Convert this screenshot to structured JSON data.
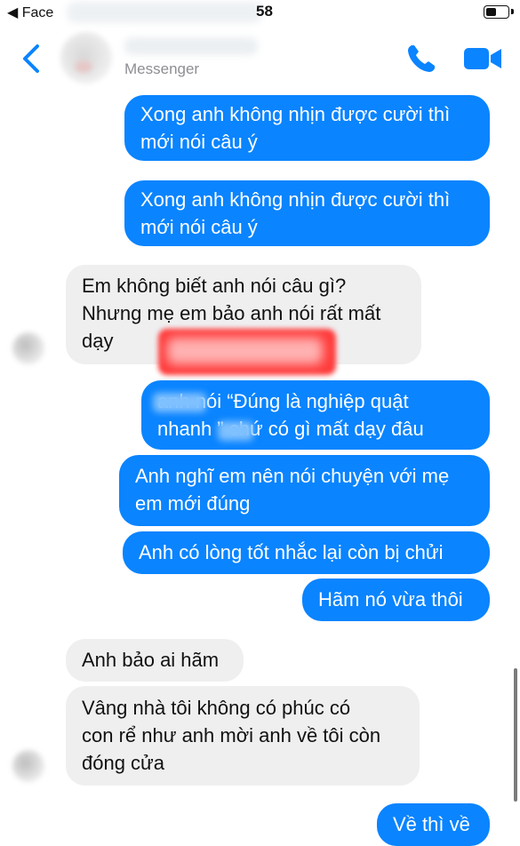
{
  "status_bar": {
    "carrier": "◀ Face",
    "time": "58"
  },
  "header": {
    "subtitle": "Messenger"
  },
  "messages": [
    {
      "direction": "out",
      "text": "Xong anh không nhịn được cười thì\nmới nói câu ý"
    },
    {
      "direction": "out",
      "text": "Xong anh không nhịn được cười thì\nmới nói câu ý"
    },
    {
      "direction": "in",
      "text": "Em không biết anh nói câu gì?\nNhưng mẹ em bảo anh nói rất mất\ndạy"
    },
    {
      "direction": "out",
      "text": "      anh nói “Đúng là nghiệp quật\nnhanh     ” chứ có gì mất dạy đâu"
    },
    {
      "direction": "out",
      "text": "Anh nghĩ em nên nói chuyện với mẹ\nem mới đúng"
    },
    {
      "direction": "out",
      "text": "Anh có lòng tốt nhắc lại còn bị chửi"
    },
    {
      "direction": "out",
      "text": "Hãm nó vừa thôi"
    },
    {
      "direction": "in",
      "text": "Anh bảo ai hãm"
    },
    {
      "direction": "in",
      "text": "Vâng nhà tôi không có phúc có\ncon rể như anh mời anh về tôi còn\nđóng cửa"
    },
    {
      "direction": "out",
      "text": "Về thì về"
    }
  ],
  "colors": {
    "outgoing_bubble": "#0a84ff",
    "incoming_bubble": "#efeff0",
    "accent": "#0a84ff"
  },
  "icons": [
    "back-chevron-icon",
    "phone-icon",
    "video-camera-icon",
    "battery-icon"
  ]
}
